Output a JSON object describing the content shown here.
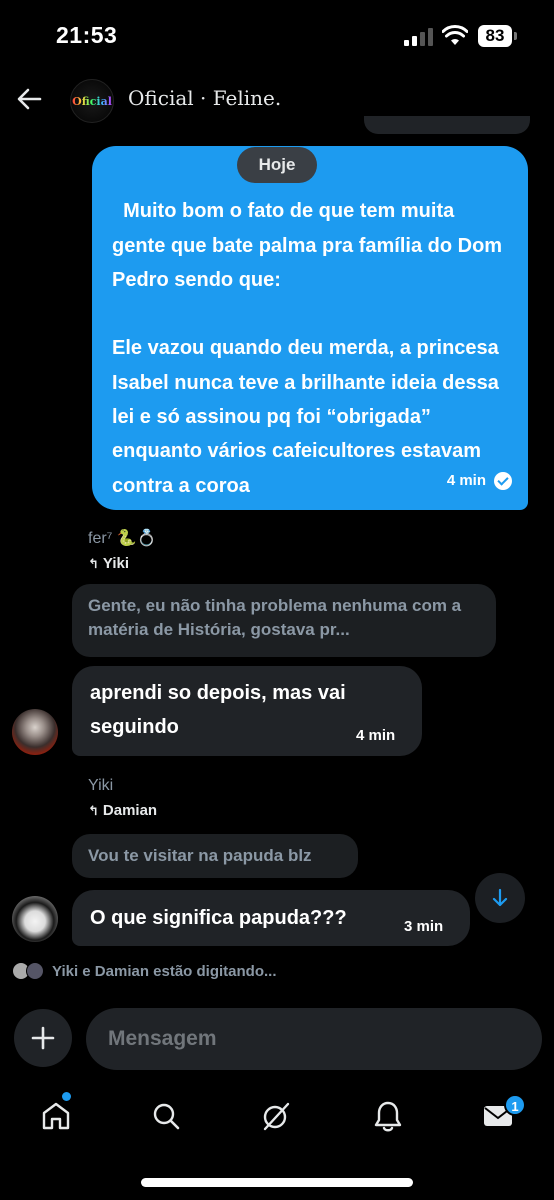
{
  "status_bar": {
    "time": "21:53",
    "battery": "83"
  },
  "header": {
    "title": "Oficial · Feline.",
    "avatar_text": "Oficial"
  },
  "date_chip": "Hoje",
  "outgoing_message": {
    "text": "Muito bom o fato de que tem muita gente que bate palma pra família do Dom Pedro sendo que:\n\nEle vazou quando deu merda, a princesa Isabel nunca teve a brilhante ideia dessa lei e só assinou pq foi “obrigada” enquanto vários cafeicultores estavam contra a coroa",
    "time": "4 min"
  },
  "messages": [
    {
      "sender": "fer⁷ 🐍💍",
      "reply_to": "Yiki",
      "quote": "Gente, eu não tinha problema nenhuma com a matéria de História, gostava pr...",
      "text": "aprendi so depois, mas vai seguindo",
      "time": "4 min"
    },
    {
      "sender": "Yiki",
      "reply_to": "Damian",
      "quote": "Vou te visitar na papuda blz",
      "text": "O que significa papuda???",
      "time": "3 min"
    }
  ],
  "typing_indicator": "Yiki e Damian estão digitando...",
  "composer": {
    "placeholder": "Mensagem"
  },
  "bottom_nav": {
    "messages_badge": "1"
  },
  "colors": {
    "accent": "#1d9bf0",
    "background": "#000000",
    "bubble_incoming": "#202327"
  }
}
